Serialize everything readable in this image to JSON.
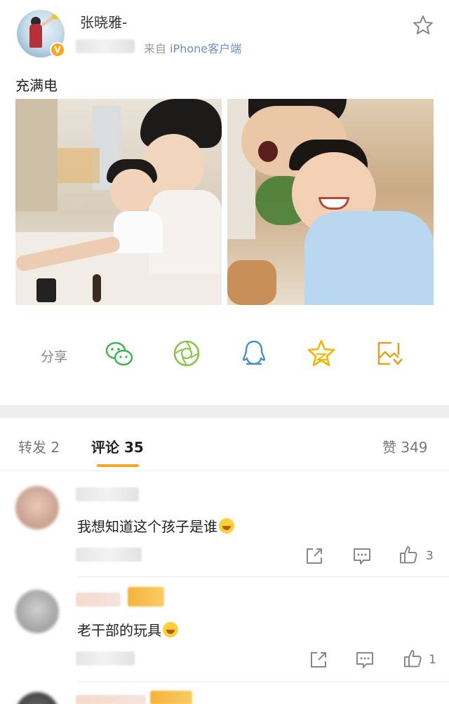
{
  "post": {
    "username": "张晓雅-",
    "source_prefix": "来自",
    "source_client": "iPhone客户端",
    "text": "充满电",
    "verified_mark": "V"
  },
  "share": {
    "label": "分享",
    "targets": [
      "wechat-icon",
      "moments-icon",
      "qq-icon",
      "qzone-star-icon",
      "save-image-icon"
    ]
  },
  "tabs": {
    "repost": "转发 2",
    "comments": "评论 35",
    "likes": "赞 349"
  },
  "comments": [
    {
      "text": "我想知道这个孩子是谁",
      "likes": "3"
    },
    {
      "text": "老干部的玩具",
      "likes": "1"
    }
  ],
  "colors": {
    "accent": "#f5a623",
    "wechat": "#3ab54a",
    "moments": "#8bc34a",
    "qq": "#4a90c8",
    "star": "#f5b400"
  }
}
